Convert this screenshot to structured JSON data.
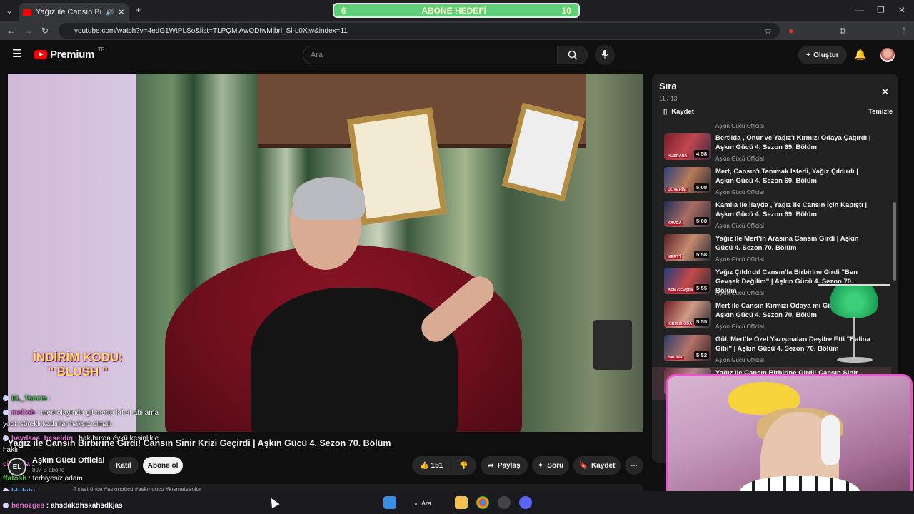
{
  "browser": {
    "tab_title": "Yağız ile Cansın Birbirine Gi",
    "url": "youtube.com/watch?v=4edG1WtPLSo&list=TLPQMjAwODIwMjbrl_Sl-L0Xjw&index=11"
  },
  "overlay_goal": {
    "left": "6",
    "label": "ABONE HEDEFİ",
    "right": "10"
  },
  "header": {
    "logo_text": "Premium",
    "logo_sup": "TR",
    "search_placeholder": "Ara",
    "create_label": "Oluştur"
  },
  "video": {
    "promo_line1": "İNDİRİM KODU:",
    "promo_line2": "\" BLUSH \"",
    "title": "Yağız ile Cansın Birbirine Girdi! Cansın Sinir Krizi Geçirdi | Aşkın Gücü 4. Sezon 70. Bölüm",
    "channel": "Aşkın Gücü Official",
    "subs": "897 B abone",
    "join_label": "Katıl",
    "subscribe_label": "Abone ol",
    "likes": "151",
    "share_label": "Paylaş",
    "ask_label": "Soru",
    "save_label": "Kaydet",
    "description_snippet": "4 saat önce  #aşkıngücü #aşkıngucu #kısmetseolur"
  },
  "chat": [
    {
      "user": "EL_Tanem",
      "text": ":"
    },
    {
      "user": "meltob",
      "text": ": mert olayında git merte laf et abi ama"
    },
    {
      "user": "",
      "text": "yook sürekli kadınlar haksız olmalı"
    },
    {
      "user": "haydaaa_beseldiq",
      "text": ": hak burda öykü kesinlikle"
    },
    {
      "user": "",
      "text": "haklı"
    },
    {
      "user": "cirasola",
      "text": ":"
    },
    {
      "user": "ffatosh",
      "text": ": terbiyesiz adam"
    },
    {
      "user": "blulutu",
      "text": ""
    },
    {
      "user": "benozges",
      "text": ": ahsdakdhskahsdkjas"
    }
  ],
  "playlist": {
    "title": "Sıra",
    "count": "11 / 13",
    "save_label": "Kaydet",
    "clear_label": "Temizle",
    "top_channel": "Aşkın Gücü Official",
    "items": [
      {
        "title": "Bertilda , Onur ve Yağız'ı Kırmızı Odaya Çağırdı | Aşkın Gücü 4. Sezon 69. Bölüm",
        "channel": "Aşkın Gücü Official",
        "duration": "4:58",
        "tag": "HUSRANA"
      },
      {
        "title": "Mert, Cansın'ı Tanımak İstedi, Yağız Çıldırdı | Aşkın Gücü 4. Sezon 69. Bölüm",
        "channel": "Aşkın Gücü Official",
        "duration": "5:09",
        "tag": "DÖVERİM"
      },
      {
        "title": "Kamila ile İlayda , Yağız ile Cansın İçin Kapıştı | Aşkın Gücü 4. Sezon 69. Bölüm",
        "channel": "Aşkın Gücü Official",
        "duration": "5:08",
        "tag": "KAVGA"
      },
      {
        "title": "Yağız ile Mert'in Arasına Cansın Girdi | Aşkın Gücü 4. Sezon 70. Bölüm",
        "channel": "Aşkın Gücü Official",
        "duration": "5:58",
        "tag": "MERT'İ"
      },
      {
        "title": "Yağız Çıldırdı! Cansın'la Birbirine Girdi \"Ben Gevşek Değilim\" | Aşkın Gücü 4. Sezon 70. Bölüm",
        "channel": "Aşkın Gücü Official",
        "duration": "5:55",
        "tag": "BEN GEVŞEK"
      },
      {
        "title": "Mert ile Cansın Kırmızı Odaya mı Gidecek? | Aşkın Gücü 4. Sezon 70. Bölüm",
        "channel": "Aşkın Gücü Official",
        "duration": "5:55",
        "tag": "KIRMIZI ODA"
      },
      {
        "title": "Gül, Mert'le Özel Yazışmaları Deşifre Etti \"Balina Gibi\" | Aşkın Gücü 4. Sezon 70. Bölüm",
        "channel": "Aşkın Gücü Official",
        "duration": "5:52",
        "tag": "BALİNA"
      },
      {
        "title": "Yağız ile Cansın Birbirine Girdi! Cansın Sinir Krizi Geçirdi",
        "channel": "",
        "duration": "",
        "tag": ""
      }
    ]
  },
  "taskbar": {
    "search_label": "Ara"
  },
  "colors": {
    "accent_red": "#ff0000",
    "overlay_green": "#5fcf79",
    "cam_border": "#e256c9"
  }
}
